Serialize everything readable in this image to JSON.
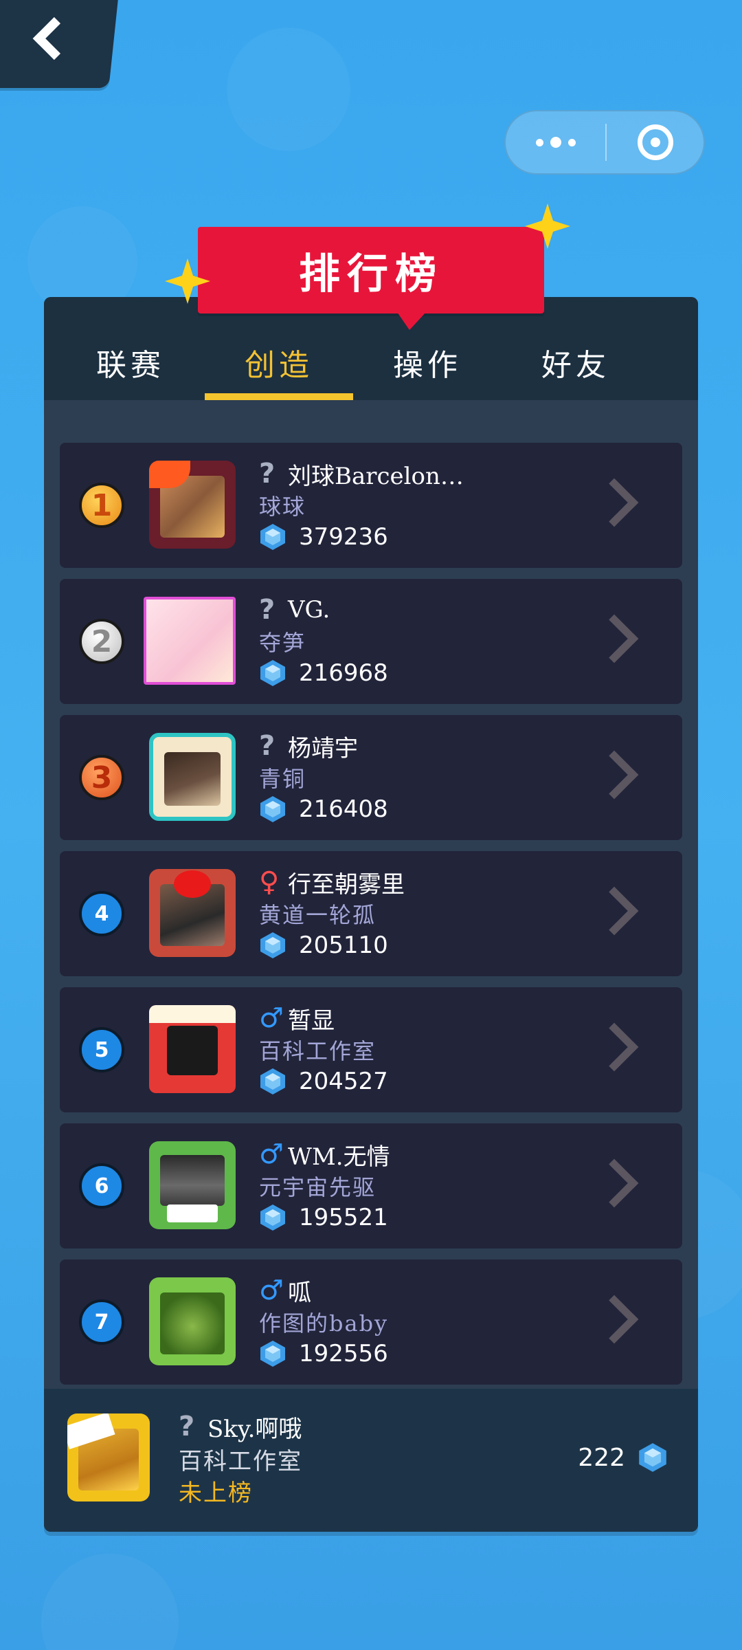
{
  "nav": {
    "back_icon": "chevron-left-icon"
  },
  "capsule": {
    "more_icon": "more-dots-icon",
    "close_icon": "target-circle-icon"
  },
  "header": {
    "title": "排行榜"
  },
  "tabs": [
    {
      "label": "联赛",
      "active": false
    },
    {
      "label": "创造",
      "active": true
    },
    {
      "label": "操作",
      "active": false
    },
    {
      "label": "好友",
      "active": false
    }
  ],
  "ranking": [
    {
      "rank": "1",
      "badge": "gold",
      "gender": "?",
      "gender_type": "unknown",
      "name": "刘球Barcelon…",
      "title": "球球",
      "score": "379236"
    },
    {
      "rank": "2",
      "badge": "silver",
      "gender": "?",
      "gender_type": "unknown",
      "name": "VG.",
      "title": "夺笋",
      "score": "216968"
    },
    {
      "rank": "3",
      "badge": "bronze",
      "gender": "?",
      "gender_type": "unknown",
      "name": "杨靖宇",
      "title": "青铜",
      "score": "216408"
    },
    {
      "rank": "4",
      "badge": "blue",
      "gender": "♀",
      "gender_type": "female",
      "name": "行至朝雾里",
      "title": "黄道一轮孤",
      "score": "205110"
    },
    {
      "rank": "5",
      "badge": "blue",
      "gender": "♂",
      "gender_type": "male",
      "name": "暂显",
      "title": "百科工作室",
      "score": "204527"
    },
    {
      "rank": "6",
      "badge": "blue",
      "gender": "♂",
      "gender_type": "male",
      "name": "WM.无情",
      "title": "元宇宙先驱",
      "score": "195521"
    },
    {
      "rank": "7",
      "badge": "blue",
      "gender": "♂",
      "gender_type": "male",
      "name": "呱",
      "title": "作图的baby",
      "score": "192556"
    }
  ],
  "me": {
    "gender": "?",
    "name": "Sky.啊哦",
    "title": "百科工作室",
    "status": "未上榜",
    "score": "222"
  },
  "colors": {
    "background": "#45b1f1",
    "panel": "#2d3e52",
    "row": "#22243a",
    "active_tab": "#f4c233",
    "ribbon": "#e8153a",
    "title_text": "#a3a6d6"
  }
}
